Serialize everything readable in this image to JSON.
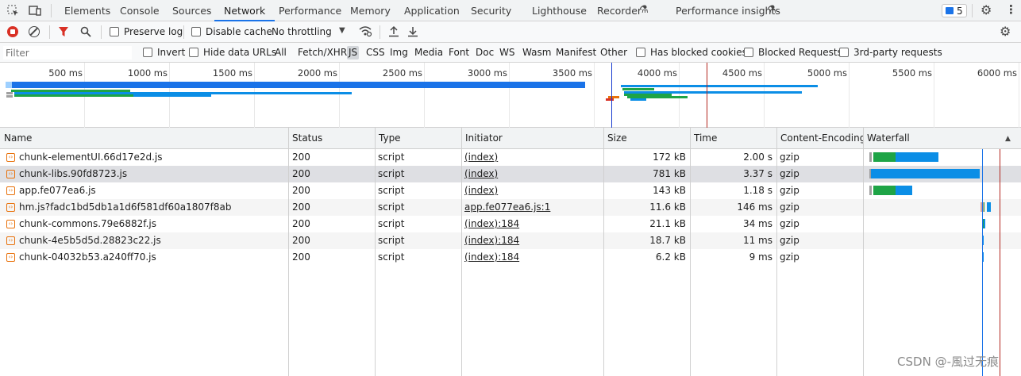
{
  "tabs": [
    "Elements",
    "Console",
    "Sources",
    "Network",
    "Performance",
    "Memory",
    "Application",
    "Security",
    "Lighthouse",
    "Recorder",
    "Performance insights"
  ],
  "active_tab": "Network",
  "issues_count": "5",
  "toolbar": {
    "preserve_log": "Preserve log",
    "disable_cache": "Disable cache",
    "throttling": "No throttling"
  },
  "filterbar": {
    "filter_placeholder": "Filter",
    "invert": "Invert",
    "hide_data_urls": "Hide data URLs",
    "types": [
      "All",
      "Fetch/XHR",
      "JS",
      "CSS",
      "Img",
      "Media",
      "Font",
      "Doc",
      "WS",
      "Wasm",
      "Manifest",
      "Other"
    ],
    "selected_type": "JS",
    "has_blocked_cookies": "Has blocked cookies",
    "blocked_requests": "Blocked Requests",
    "third_party": "3rd-party requests"
  },
  "overview_ticks": [
    "500 ms",
    "1000 ms",
    "1500 ms",
    "2000 ms",
    "2500 ms",
    "3000 ms",
    "3500 ms",
    "4000 ms",
    "4500 ms",
    "5000 ms",
    "5500 ms",
    "6000 ms"
  ],
  "columns": [
    "Name",
    "Status",
    "Type",
    "Initiator",
    "Size",
    "Time",
    "Content-Encoding",
    "Waterfall"
  ],
  "rows": [
    {
      "name": "chunk-elementUI.66d17e2d.js",
      "status": "200",
      "type": "script",
      "initiator": "(index)",
      "size": "172 kB",
      "time": "2.00 s",
      "encoding": "gzip"
    },
    {
      "name": "chunk-libs.90fd8723.js",
      "status": "200",
      "type": "script",
      "initiator": "(index)",
      "size": "781 kB",
      "time": "3.37 s",
      "encoding": "gzip"
    },
    {
      "name": "app.fe077ea6.js",
      "status": "200",
      "type": "script",
      "initiator": "(index)",
      "size": "143 kB",
      "time": "1.18 s",
      "encoding": "gzip"
    },
    {
      "name": "hm.js?fadc1bd5db1a1d6f581df60a1807f8ab",
      "status": "200",
      "type": "script",
      "initiator": "app.fe077ea6.js:1",
      "size": "11.6 kB",
      "time": "146 ms",
      "encoding": "gzip"
    },
    {
      "name": "chunk-commons.79e6882f.js",
      "status": "200",
      "type": "script",
      "initiator": "(index):184",
      "size": "21.1 kB",
      "time": "34 ms",
      "encoding": "gzip"
    },
    {
      "name": "chunk-4e5b5d5d.28823c22.js",
      "status": "200",
      "type": "script",
      "initiator": "(index):184",
      "size": "18.7 kB",
      "time": "11 ms",
      "encoding": "gzip"
    },
    {
      "name": "chunk-04032b53.a240ff70.js",
      "status": "200",
      "type": "script",
      "initiator": "(index):184",
      "size": "6.2 kB",
      "time": "9 ms",
      "encoding": "gzip"
    }
  ],
  "watermark": "CSDN @-風过无痕",
  "colors": {
    "accent": "#1a73e8",
    "download": "#0b8ee6",
    "waiting": "#1ea446",
    "record": "#d93025",
    "load_line": "#b3261e"
  }
}
